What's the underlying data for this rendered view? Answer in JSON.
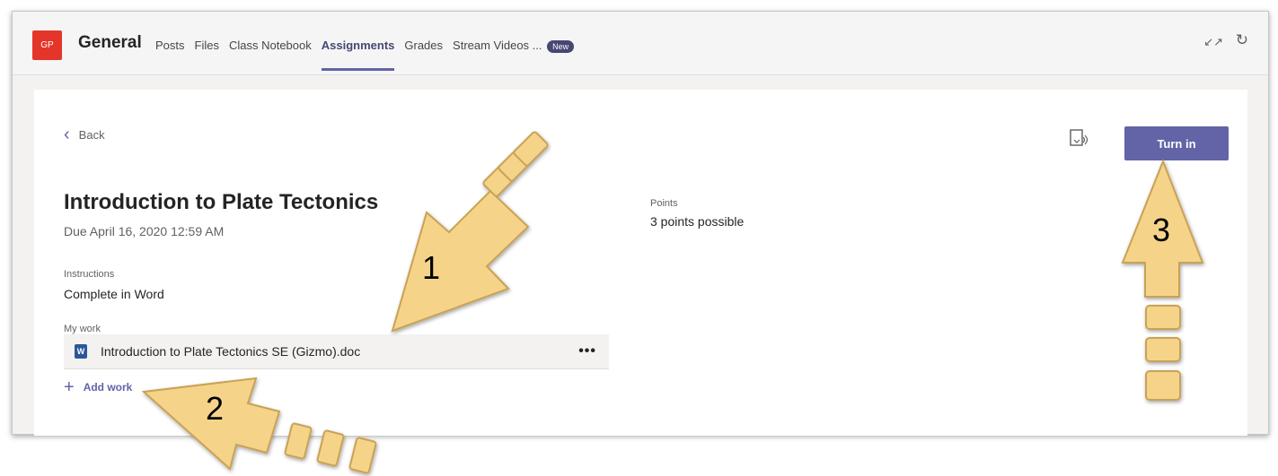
{
  "header": {
    "team_initials": "GP",
    "channel_name": "General",
    "tabs": [
      {
        "label": "Posts",
        "active": false
      },
      {
        "label": "Files",
        "active": false
      },
      {
        "label": "Class Notebook",
        "active": false
      },
      {
        "label": "Assignments",
        "active": true
      },
      {
        "label": "Grades",
        "active": false
      },
      {
        "label": "Stream Videos ...",
        "active": false
      }
    ],
    "new_badge": "New",
    "expand_icon": "expand-icon",
    "refresh_icon": "refresh-icon"
  },
  "assignment": {
    "back_label": "Back",
    "title": "Introduction to Plate Tectonics",
    "due": "Due April 16, 2020 12:59 AM",
    "instructions_label": "Instructions",
    "instructions": "Complete in Word",
    "my_work_label": "My work",
    "work_file": "Introduction to Plate Tectonics SE (Gizmo).doc",
    "more_label": "•••",
    "add_work_label": "Add work",
    "points_label": "Points",
    "points_value": "3 points possible",
    "turn_in_label": "Turn in"
  },
  "annotations": {
    "arrow1": "1",
    "arrow2": "2",
    "arrow3": "3"
  },
  "colors": {
    "accent": "#6264a7",
    "team_avatar": "#e4352b",
    "arrow_fill": "#f5d48a",
    "arrow_stroke": "#c9a254"
  }
}
